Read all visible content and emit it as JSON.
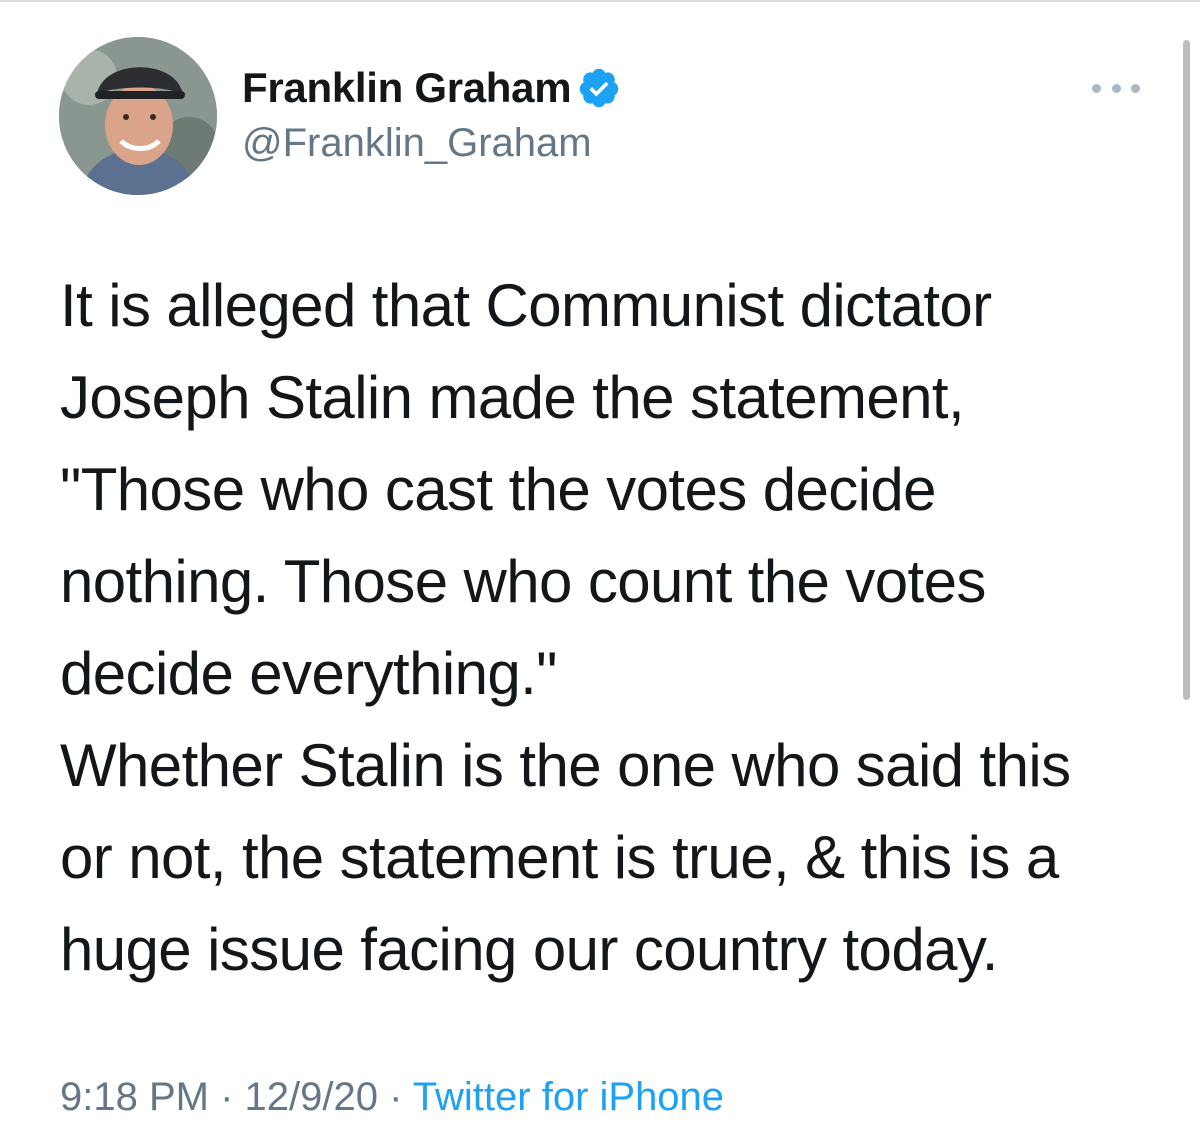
{
  "author": {
    "display_name": "Franklin Graham",
    "handle": "@Franklin_Graham",
    "verified": true,
    "avatar_icon": "profile-photo"
  },
  "tweet": {
    "text": "It is alleged that Communist dictator\nJoseph Stalin made the statement,\n\"Those who cast the votes decide\nnothing. Those who count the votes\ndecide everything.\"\nWhether Stalin is the one who said this\nor not, the statement is true, & this is a\nhuge issue facing our country today.",
    "time": "9:18 PM · 12/9/20 · ",
    "source": "Twitter for iPhone"
  },
  "menu": {
    "icon": "more-icon"
  },
  "colors": {
    "text": "#14171a",
    "secondary": "#657786",
    "verified": "#1da1f2",
    "link": "#1da1f2"
  }
}
